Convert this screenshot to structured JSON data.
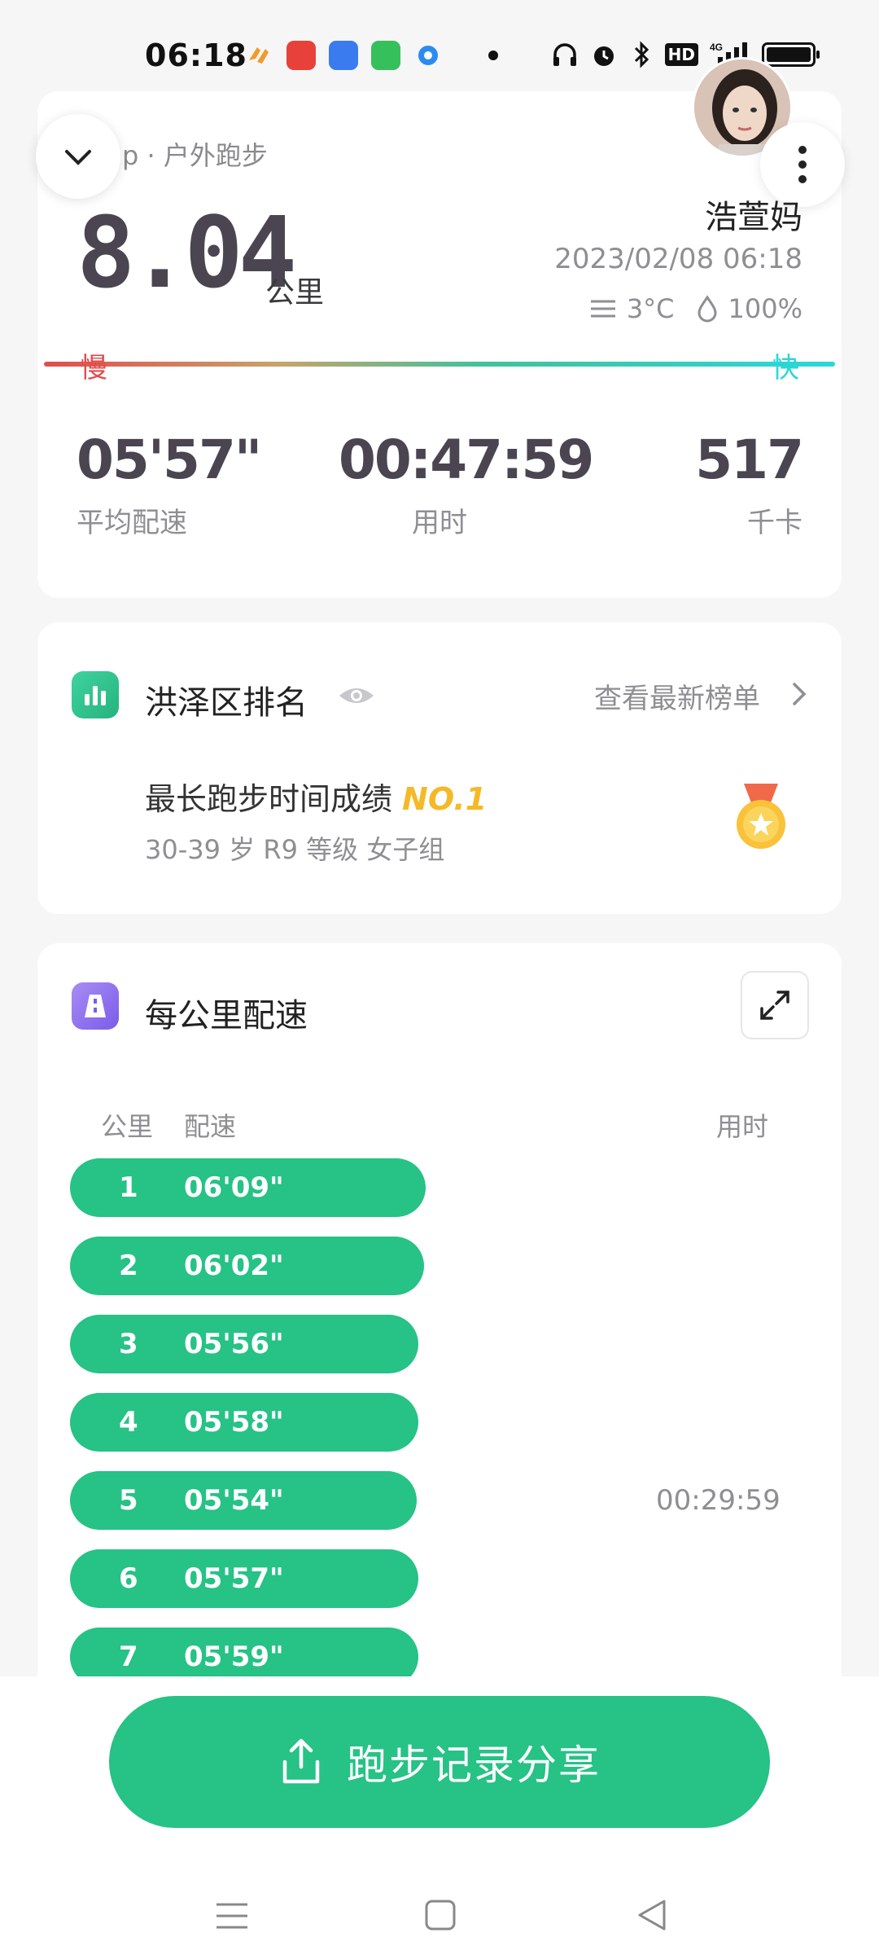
{
  "status_bar": {
    "time": "06:18",
    "hd": "HD",
    "network": "4G"
  },
  "summary": {
    "activity_type": "p · 户外跑步",
    "distance": "8.04",
    "distance_unit": "公里",
    "user_name": "浩萱妈",
    "datetime": "2023/02/08 06:18",
    "temperature": "3°C",
    "humidity": "100%",
    "slow_label": "慢",
    "fast_label": "快",
    "stats": {
      "avg_pace": {
        "value": "05'57\"",
        "label": "平均配速"
      },
      "duration": {
        "value": "00:47:59",
        "label": "用时"
      },
      "calories": {
        "value": "517",
        "label": "千卡"
      }
    }
  },
  "ranking": {
    "title": "洪泽区排名",
    "view_latest": "查看最新榜单",
    "achievement": "最长跑步时间成绩",
    "rank": "NO.1",
    "group": "30-39 岁 R9 等级 女子组"
  },
  "pace": {
    "title": "每公里配速",
    "col_km": "公里",
    "col_pace": "配速",
    "col_time": "用时",
    "splits": [
      {
        "km": "1",
        "pace": "06'09\"",
        "time": "",
        "bar": 0.78
      },
      {
        "km": "2",
        "pace": "06'02\"",
        "time": "",
        "bar": 0.776
      },
      {
        "km": "3",
        "pace": "05'56\"",
        "time": "",
        "bar": 0.765
      },
      {
        "km": "4",
        "pace": "05'58\"",
        "time": "",
        "bar": 0.765
      },
      {
        "km": "5",
        "pace": "05'54\"",
        "time": "00:29:59",
        "bar": 0.76
      },
      {
        "km": "6",
        "pace": "05'57\"",
        "time": "",
        "bar": 0.765
      },
      {
        "km": "7",
        "pace": "05'59\"",
        "time": "",
        "bar": 0.765
      }
    ]
  },
  "share": {
    "label": "跑步记录分享"
  },
  "colors": {
    "accent": "#26c286",
    "rank_gold": "#f5b928",
    "slow": "#e14d4d",
    "fast": "#2bd7d9"
  }
}
